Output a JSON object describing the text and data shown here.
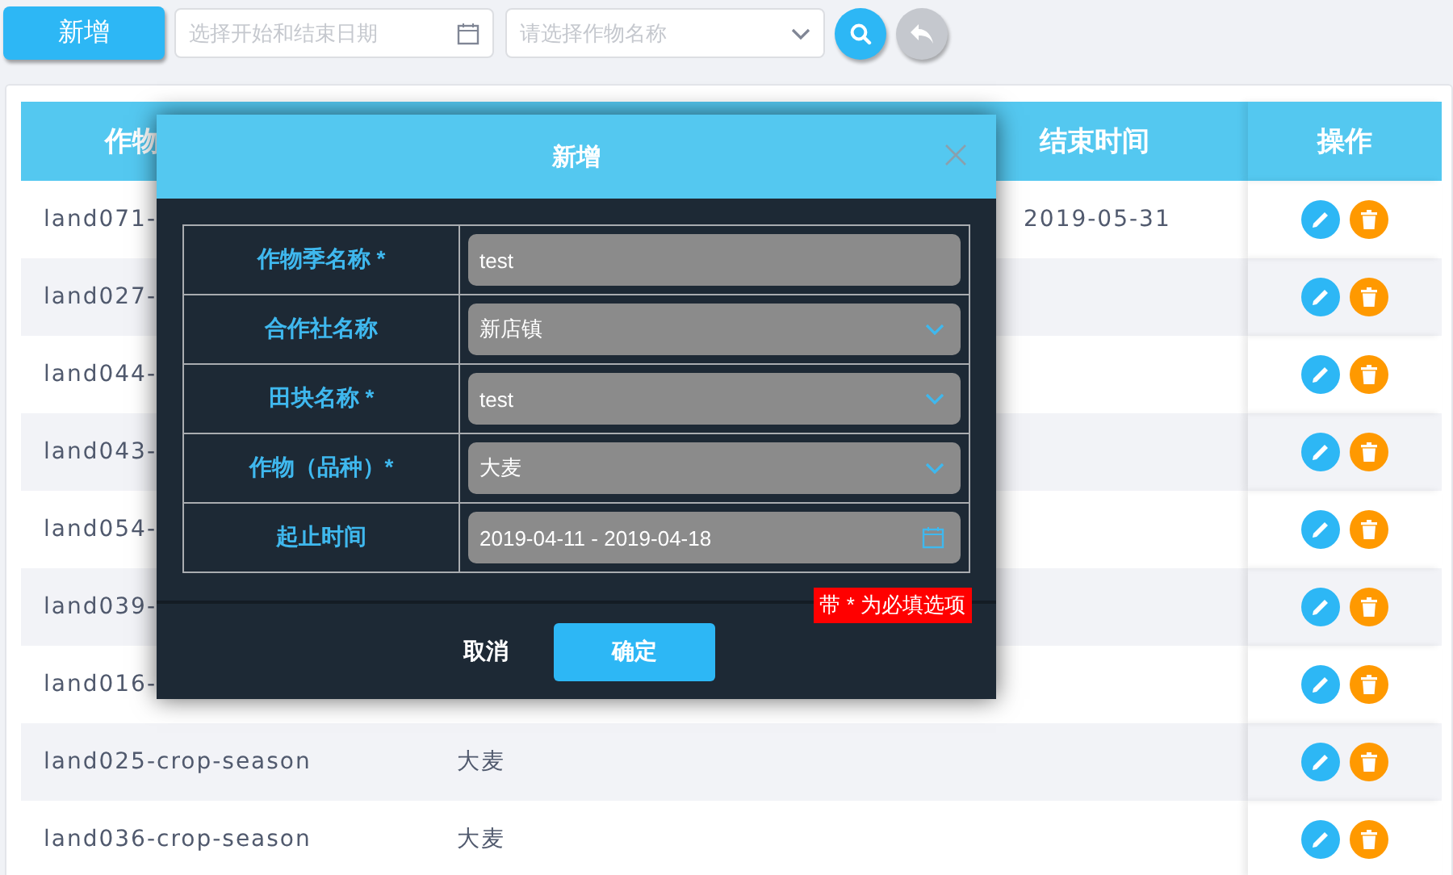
{
  "toolbar": {
    "add_button": "新增",
    "date_range": {
      "placeholder": "选择开始和结束日期"
    },
    "crop_select": {
      "placeholder": "请选择作物名称"
    }
  },
  "table": {
    "header": {
      "column_1": "作物",
      "column_3": "结束时间",
      "column_4": "操作"
    },
    "rows": [
      {
        "column_1": "land071-",
        "column_3": "2019-05-31"
      },
      {
        "column_1": "land027-"
      },
      {
        "column_1": "land044-"
      },
      {
        "column_1": "land043-"
      },
      {
        "column_1": "land054-"
      },
      {
        "column_1": "land039-"
      },
      {
        "column_1": "land016-"
      },
      {
        "column_1": "land025-crop-season",
        "column_2": "大麦"
      },
      {
        "column_1": "land036-crop-season",
        "column_2": "大麦"
      }
    ]
  },
  "dialog": {
    "title": "新增",
    "fields": [
      {
        "label": "作物季名称 *",
        "kind": "text",
        "value": "test"
      },
      {
        "label": "合作社名称",
        "kind": "select",
        "value": "新店镇"
      },
      {
        "label": "田块名称 *",
        "kind": "select",
        "value": "test"
      },
      {
        "label": "作物（品种）*",
        "kind": "select",
        "value": "大麦"
      },
      {
        "label": "起止时间",
        "kind": "date",
        "value": "2019-04-11 - 2019-04-18"
      }
    ],
    "note": "带 * 为必填选项",
    "cancel": "取消",
    "confirm": "确定"
  }
}
